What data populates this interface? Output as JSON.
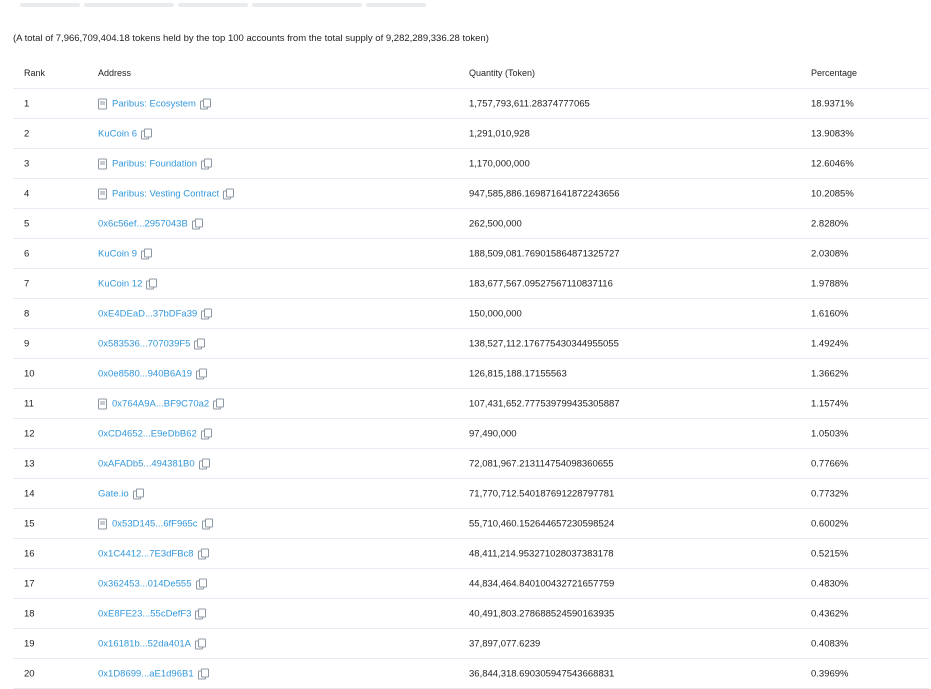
{
  "summary": "(A total of 7,966,709,404.18 tokens held by the top 100 accounts from the total supply of 9,282,289,336.28 token)",
  "table": {
    "headers": {
      "rank": "Rank",
      "address": "Address",
      "quantity": "Quantity (Token)",
      "percentage": "Percentage"
    },
    "rows": [
      {
        "rank": "1",
        "address": "Paribus: Ecosystem",
        "contract": true,
        "quantity": "1,757,793,611.28374777065",
        "percentage": "18.9371%"
      },
      {
        "rank": "2",
        "address": "KuCoin 6",
        "contract": false,
        "quantity": "1,291,010,928",
        "percentage": "13.9083%"
      },
      {
        "rank": "3",
        "address": "Paribus: Foundation",
        "contract": true,
        "quantity": "1,170,000,000",
        "percentage": "12.6046%"
      },
      {
        "rank": "4",
        "address": "Paribus: Vesting Contract",
        "contract": true,
        "quantity": "947,585,886.169871641872243656",
        "percentage": "10.2085%"
      },
      {
        "rank": "5",
        "address": "0x6c56ef...2957043B",
        "contract": false,
        "quantity": "262,500,000",
        "percentage": "2.8280%"
      },
      {
        "rank": "6",
        "address": "KuCoin 9",
        "contract": false,
        "quantity": "188,509,081.769015864871325727",
        "percentage": "2.0308%"
      },
      {
        "rank": "7",
        "address": "KuCoin 12",
        "contract": false,
        "quantity": "183,677,567.09527567110837116",
        "percentage": "1.9788%"
      },
      {
        "rank": "8",
        "address": "0xE4DEaD...37bDFa39",
        "contract": false,
        "quantity": "150,000,000",
        "percentage": "1.6160%"
      },
      {
        "rank": "9",
        "address": "0x583536...707039F5",
        "contract": false,
        "quantity": "138,527,112.176775430344955055",
        "percentage": "1.4924%"
      },
      {
        "rank": "10",
        "address": "0x0e8580...940B6A19",
        "contract": false,
        "quantity": "126,815,188.17155563",
        "percentage": "1.3662%"
      },
      {
        "rank": "11",
        "address": "0x764A9A...BF9C70a2",
        "contract": true,
        "quantity": "107,431,652.777539799435305887",
        "percentage": "1.1574%"
      },
      {
        "rank": "12",
        "address": "0xCD4652...E9eDbB62",
        "contract": false,
        "quantity": "97,490,000",
        "percentage": "1.0503%"
      },
      {
        "rank": "13",
        "address": "0xAFADb5...494381B0",
        "contract": false,
        "quantity": "72,081,967.213114754098360655",
        "percentage": "0.7766%"
      },
      {
        "rank": "14",
        "address": "Gate.io",
        "contract": false,
        "quantity": "71,770,712.540187691228797781",
        "percentage": "0.7732%"
      },
      {
        "rank": "15",
        "address": "0x53D145...6fF965c",
        "contract": true,
        "quantity": "55,710,460.152644657230598524",
        "percentage": "0.6002%"
      },
      {
        "rank": "16",
        "address": "0x1C4412...7E3dFBc8",
        "contract": false,
        "quantity": "48,411,214.953271028037383178",
        "percentage": "0.5215%"
      },
      {
        "rank": "17",
        "address": "0x362453...014De555",
        "contract": false,
        "quantity": "44,834,464.840100432721657759",
        "percentage": "0.4830%"
      },
      {
        "rank": "18",
        "address": "0xE8FE23...55cDefF3",
        "contract": false,
        "quantity": "40,491,803.278688524590163935",
        "percentage": "0.4362%"
      },
      {
        "rank": "19",
        "address": "0x16181b...52da401A",
        "contract": false,
        "quantity": "37,897,077.6239",
        "percentage": "0.4083%"
      },
      {
        "rank": "20",
        "address": "0x1D8699...aE1d96B1",
        "contract": false,
        "quantity": "36,844,318.690305947543668831",
        "percentage": "0.3969%"
      }
    ]
  },
  "colors": {
    "link": "#3498db",
    "text": "#1e2022",
    "border": "#e7eaf3",
    "icon": "#8c98a4"
  },
  "icons": {
    "contract": "contract-file-icon",
    "copy": "copy-icon"
  }
}
